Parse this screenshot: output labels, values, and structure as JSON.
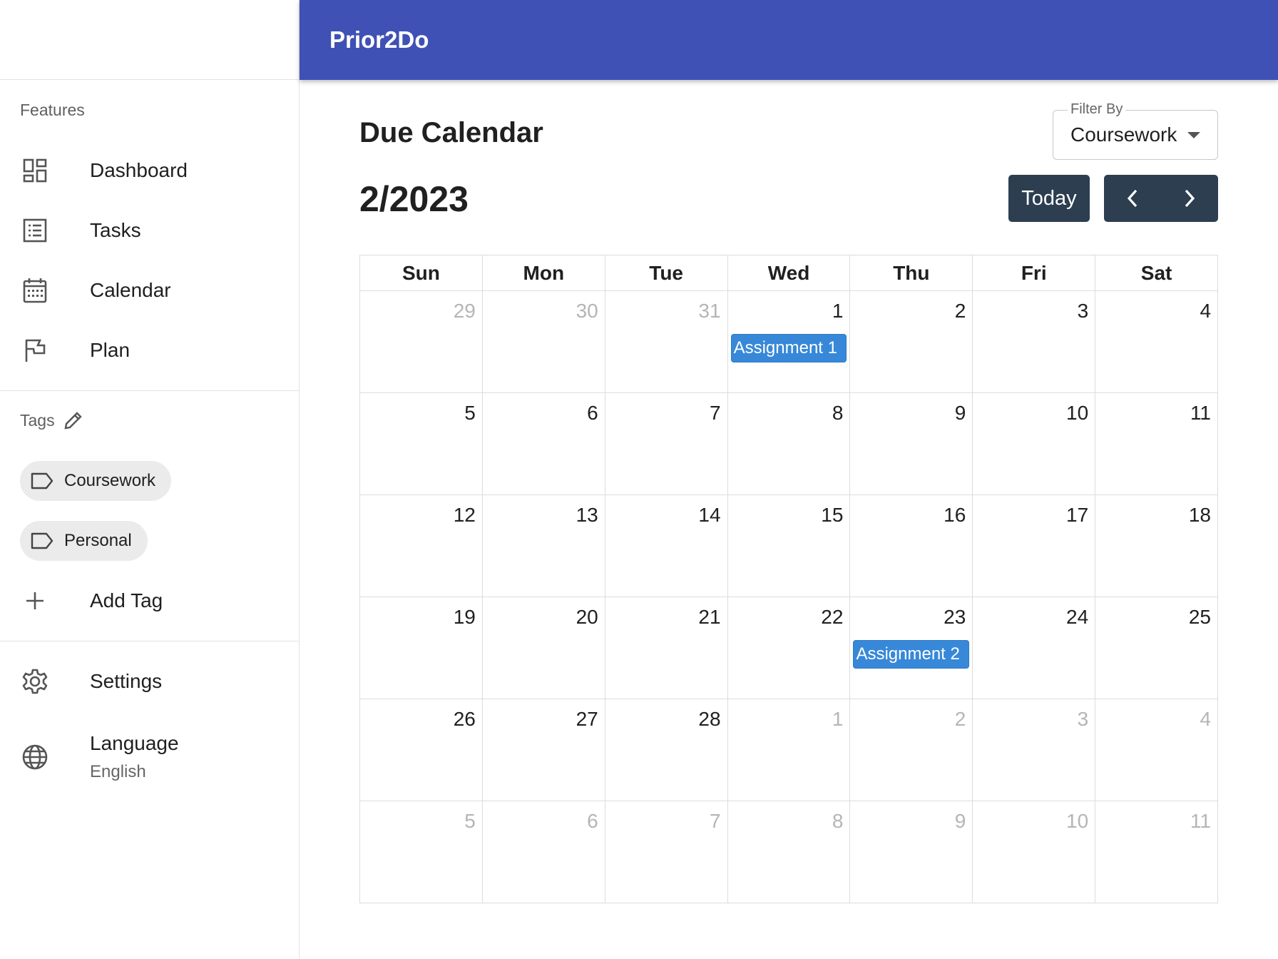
{
  "app": {
    "title": "Prior2Do"
  },
  "sidebar": {
    "features_title": "Features",
    "items": [
      {
        "label": "Dashboard",
        "icon": "dashboard-icon"
      },
      {
        "label": "Tasks",
        "icon": "list-icon"
      },
      {
        "label": "Calendar",
        "icon": "calendar-icon"
      },
      {
        "label": "Plan",
        "icon": "flag-icon"
      }
    ],
    "tags_title": "Tags",
    "tags": [
      {
        "label": "Coursework",
        "icon": "label-icon"
      },
      {
        "label": "Personal",
        "icon": "label-icon"
      }
    ],
    "add_tag_label": "Add Tag",
    "settings_label": "Settings",
    "language_label": "Language",
    "language_value": "English"
  },
  "main": {
    "title": "Due Calendar",
    "month": "2/2023",
    "filter": {
      "legend": "Filter By",
      "value": "Coursework"
    },
    "today_label": "Today",
    "weekdays": [
      "Sun",
      "Mon",
      "Tue",
      "Wed",
      "Thu",
      "Fri",
      "Sat"
    ],
    "weeks": [
      [
        {
          "day": "29",
          "other": true
        },
        {
          "day": "30",
          "other": true
        },
        {
          "day": "31",
          "other": true
        },
        {
          "day": "1",
          "event": "Assignment 1"
        },
        {
          "day": "2"
        },
        {
          "day": "3"
        },
        {
          "day": "4"
        }
      ],
      [
        {
          "day": "5"
        },
        {
          "day": "6"
        },
        {
          "day": "7"
        },
        {
          "day": "8"
        },
        {
          "day": "9"
        },
        {
          "day": "10"
        },
        {
          "day": "11"
        }
      ],
      [
        {
          "day": "12"
        },
        {
          "day": "13"
        },
        {
          "day": "14"
        },
        {
          "day": "15"
        },
        {
          "day": "16"
        },
        {
          "day": "17"
        },
        {
          "day": "18"
        }
      ],
      [
        {
          "day": "19"
        },
        {
          "day": "20"
        },
        {
          "day": "21"
        },
        {
          "day": "22"
        },
        {
          "day": "23",
          "event": "Assignment 2"
        },
        {
          "day": "24"
        },
        {
          "day": "25"
        }
      ],
      [
        {
          "day": "26"
        },
        {
          "day": "27"
        },
        {
          "day": "28"
        },
        {
          "day": "1",
          "other": true
        },
        {
          "day": "2",
          "other": true
        },
        {
          "day": "3",
          "other": true
        },
        {
          "day": "4",
          "other": true
        }
      ],
      [
        {
          "day": "5",
          "other": true
        },
        {
          "day": "6",
          "other": true
        },
        {
          "day": "7",
          "other": true
        },
        {
          "day": "8",
          "other": true
        },
        {
          "day": "9",
          "other": true
        },
        {
          "day": "10",
          "other": true
        },
        {
          "day": "11",
          "other": true
        }
      ]
    ]
  },
  "colors": {
    "appbar": "#3f51b5",
    "button": "#2c3e50",
    "event": "#3788d8"
  }
}
